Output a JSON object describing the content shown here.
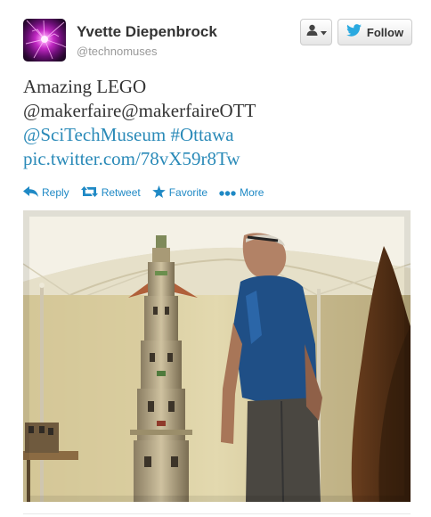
{
  "user": {
    "fullname": "Yvette Diepenbrock",
    "username": "@technomuses",
    "avatar_icon": "purple-plasma-avatar"
  },
  "buttons": {
    "user_dropdown_icon": "person-icon",
    "follow_label": "Follow",
    "follow_icon": "twitter-bird-icon"
  },
  "tweet": {
    "line1": "Amazing LEGO",
    "line2": "@makerfaire@makerfaireOTT",
    "mention": "@SciTechMuseum",
    "hashtag": "#Ottawa",
    "photo_link": "pic.twitter.com/78vX59r8Tw"
  },
  "actions": {
    "reply": "Reply",
    "retweet": "Retweet",
    "favorite": "Favorite",
    "more": "More"
  },
  "colors": {
    "link": "#2a8ab8",
    "action": "#1f89c5",
    "name": "#333333",
    "muted": "#999999"
  }
}
